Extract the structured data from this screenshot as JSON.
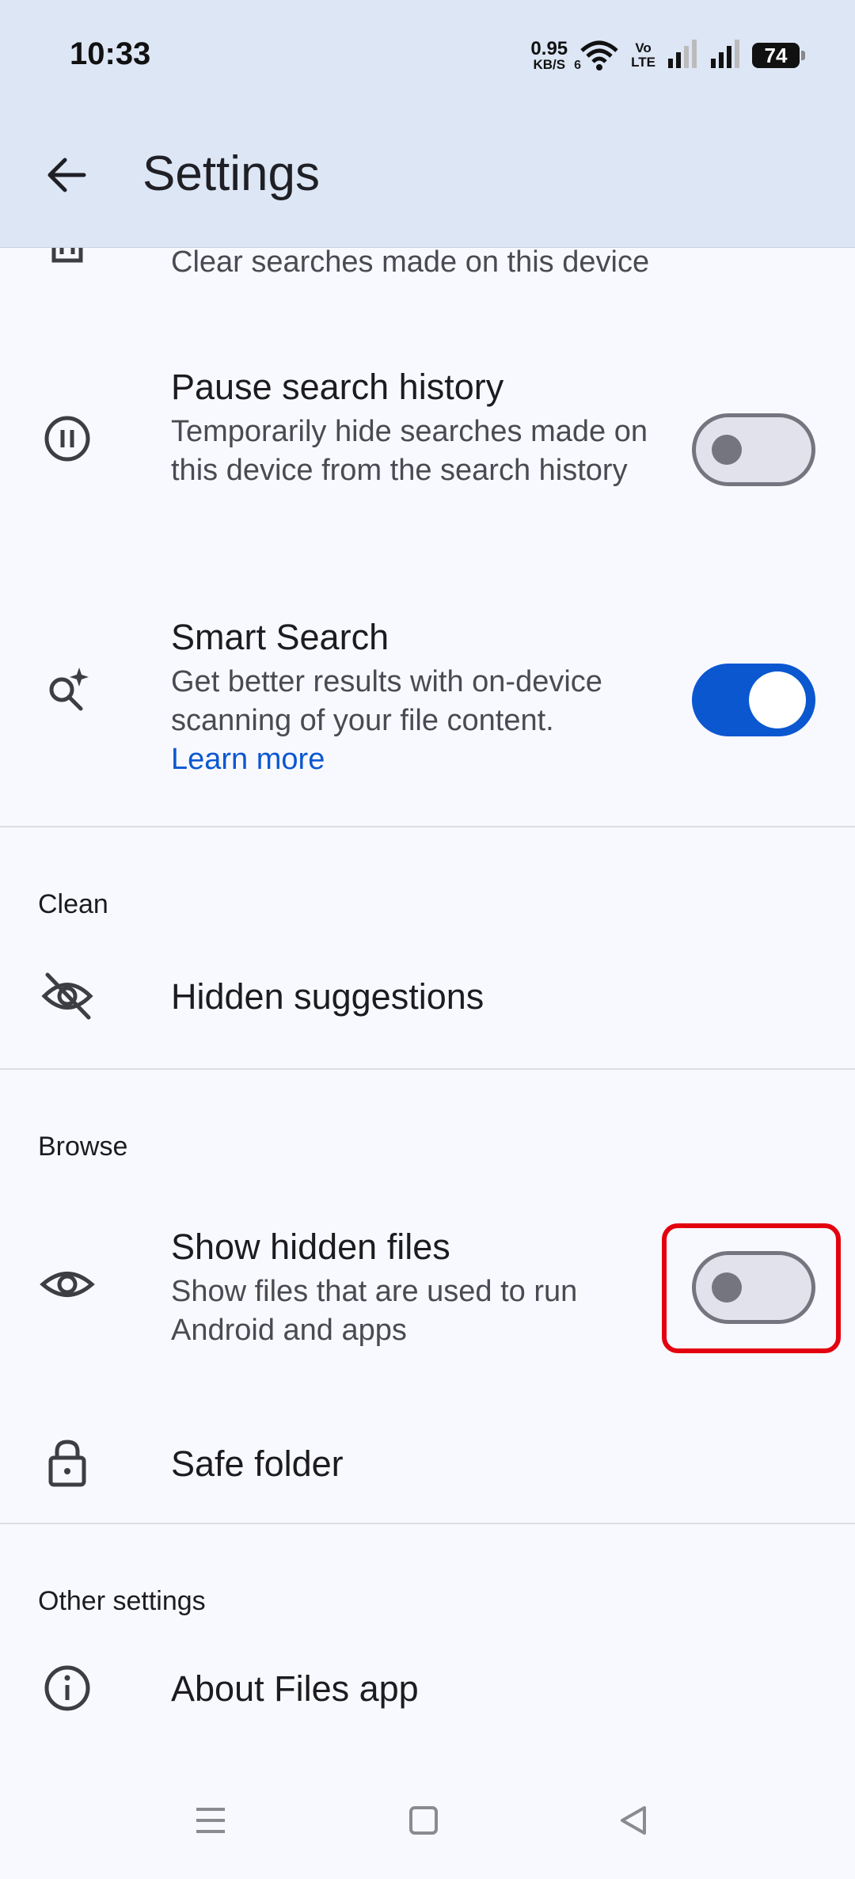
{
  "status_bar": {
    "time": "10:33",
    "net_speed_value": "0.95",
    "net_speed_unit": "KB/S",
    "wifi_badge": "6",
    "volte_line1": "Vo",
    "volte_line2": "LTE",
    "battery": "74"
  },
  "app_bar": {
    "title": "Settings",
    "back_icon": "arrow-back-icon"
  },
  "items": {
    "clear_history_subtitle": "Clear searches made on this device",
    "pause_history": {
      "title": "Pause search history",
      "subtitle": "Temporarily hide searches made on this device from the search history",
      "toggle_on": false
    },
    "smart_search": {
      "title": "Smart Search",
      "subtitle": "Get better results with on-device scanning of your file content.",
      "link": "Learn more",
      "toggle_on": true
    },
    "hidden_suggestions": {
      "title": "Hidden suggestions"
    },
    "show_hidden_files": {
      "title": "Show hidden files",
      "subtitle": "Show files that are used to run Android and apps",
      "toggle_on": false
    },
    "safe_folder": {
      "title": "Safe folder"
    },
    "about": {
      "title": "About Files app"
    }
  },
  "sections": {
    "clean": "Clean",
    "browse": "Browse",
    "other": "Other settings"
  },
  "colors": {
    "accent": "#0b57d0",
    "highlight": "#e3000f",
    "app_bar_bg": "#dde6f5"
  }
}
